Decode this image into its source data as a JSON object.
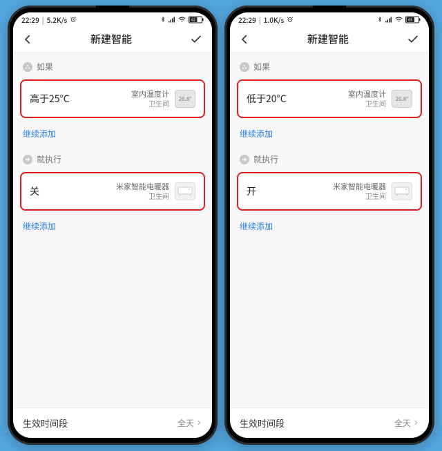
{
  "screens": [
    {
      "status": {
        "time": "22:29",
        "speed": "5.2K/s",
        "battery": "62"
      },
      "nav": {
        "title": "新建智能"
      },
      "if_label": "如果",
      "if_card": {
        "main": "高于25°C",
        "device_name": "室内温度计",
        "device_room": "卫生间",
        "thumb_text": "26.8°"
      },
      "add_more_if": "继续添加",
      "then_label": "就执行",
      "then_card": {
        "main": "关",
        "device_name": "米家智能电暖器",
        "device_room": "卫生间"
      },
      "add_more_then": "继续添加",
      "bottom": {
        "label": "生效时间段",
        "value": "全天"
      }
    },
    {
      "status": {
        "time": "22:29",
        "speed": "1.0K/s",
        "battery": "63"
      },
      "nav": {
        "title": "新建智能"
      },
      "if_label": "如果",
      "if_card": {
        "main": "低于20°C",
        "device_name": "室内温度计",
        "device_room": "卫生间",
        "thumb_text": "26.8°"
      },
      "add_more_if": "继续添加",
      "then_label": "就执行",
      "then_card": {
        "main": "开",
        "device_name": "米家智能电暖器",
        "device_room": "卫生间"
      },
      "add_more_then": "继续添加",
      "bottom": {
        "label": "生效时间段",
        "value": "全天"
      }
    }
  ]
}
